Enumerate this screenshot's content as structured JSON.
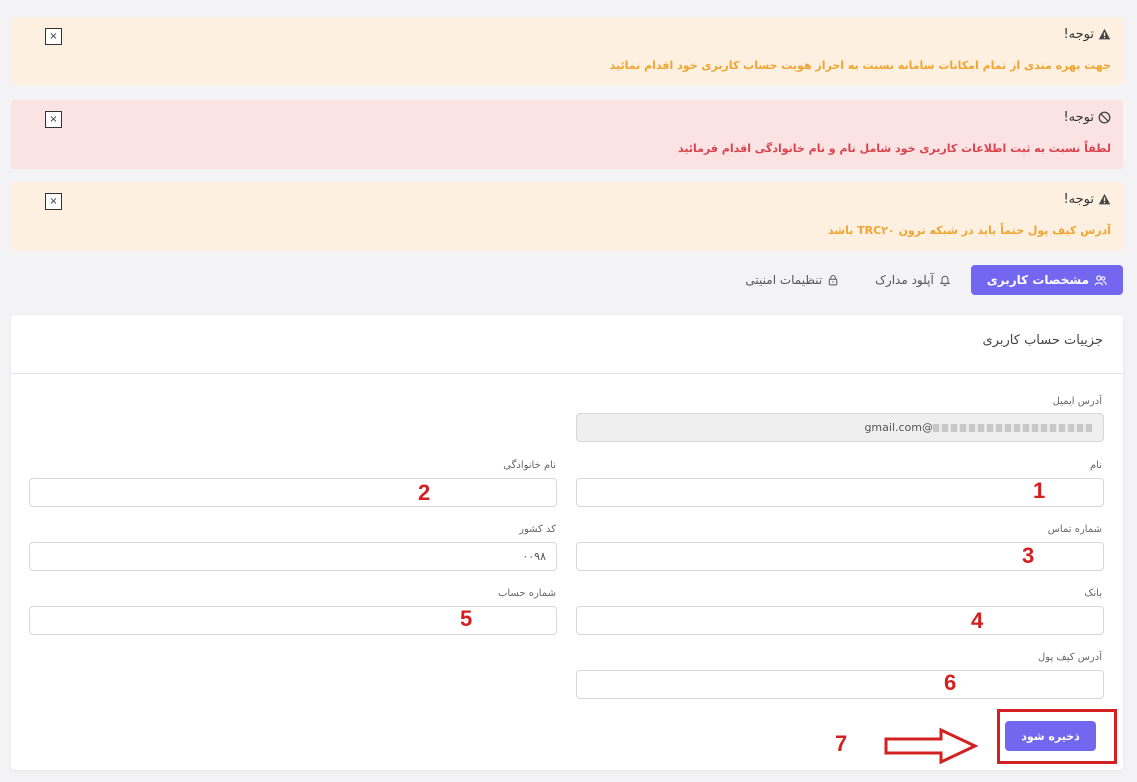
{
  "alerts": [
    {
      "type": "warning",
      "title": "توجه!",
      "message": "جهت بهره مندی از تمام امکانات سامانه نسبت به احراز هویت حساب کاربری خود اقدام نمائید",
      "close": "×"
    },
    {
      "type": "danger",
      "title": "توجه!",
      "message": "لطفاً نسبت به ثبت اطلاعات کاربری خود شامل نام و نام خانوادگی اقدام فرمائید",
      "close": "×"
    },
    {
      "type": "warning",
      "title": "توجه!",
      "message": "آدرس کیف پول حتماً باید در شبکه ترون TRC۲۰ باشد",
      "close": "×"
    }
  ],
  "tabs": [
    {
      "label": "مشخصات کاربری",
      "icon": "users-icon",
      "active": true
    },
    {
      "label": "آپلود مدارک",
      "icon": "bell-icon",
      "active": false
    },
    {
      "label": "تنظیمات امنیتی",
      "icon": "lock-icon",
      "active": false
    }
  ],
  "card": {
    "title": "جزییات حساب کاربری"
  },
  "form": {
    "email": {
      "label": "آدرس ایمیل",
      "value": "@gmail.com"
    },
    "first_name": {
      "label": "نام",
      "value": ""
    },
    "last_name": {
      "label": "نام خانوادگی",
      "value": ""
    },
    "phone": {
      "label": "شماره تماس",
      "value": ""
    },
    "country_code": {
      "label": "کد کشور",
      "value": "۰۰۹۸"
    },
    "bank": {
      "label": "بانک",
      "value": ""
    },
    "account_number": {
      "label": "شماره حساب",
      "value": ""
    },
    "wallet": {
      "label": "آدرس کیف پول",
      "value": ""
    }
  },
  "annotations": [
    "1",
    "2",
    "3",
    "4",
    "5",
    "6",
    "7"
  ],
  "save_label": "ذخیره شود",
  "colors": {
    "primary": "#7367f0",
    "warning_bg": "#fdf0e0",
    "warning_text": "#f0a531",
    "danger_bg": "#fbe3e3",
    "danger_text": "#d9434e",
    "annotation": "#d32020"
  }
}
